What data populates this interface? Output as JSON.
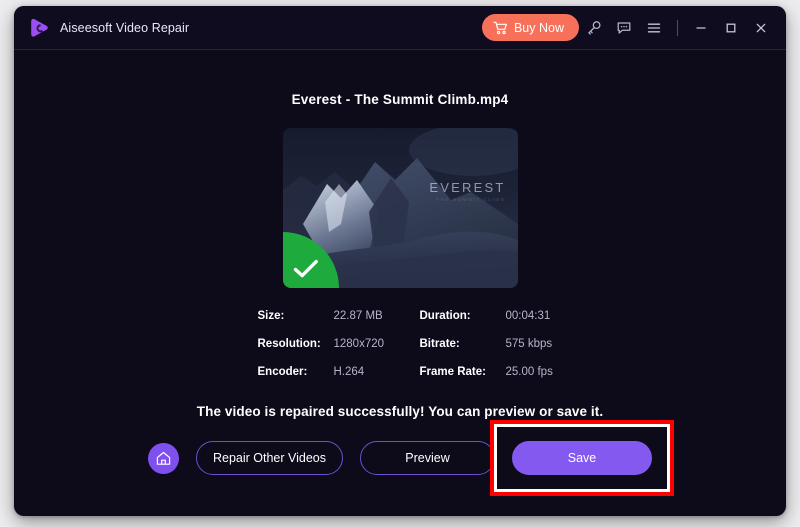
{
  "titlebar": {
    "app_name": "Aiseesoft Video Repair",
    "logo_icon": "aiseesoft-play-logo",
    "buy_now_label": "Buy Now",
    "cart_icon": "shopping-cart-icon",
    "key_icon": "key-icon",
    "feedback_icon": "chat-bubble-icon",
    "menu_icon": "hamburger-menu-icon",
    "minimize_icon": "minimize-icon",
    "maximize_icon": "maximize-icon",
    "close_icon": "close-icon"
  },
  "main": {
    "file_title": "Everest - The Summit Climb.mp4",
    "thumbnail": {
      "overlay_title": "EVEREST",
      "overlay_subtitle": "THE SUMMIT CLIMB",
      "badge_icon": "green-check-badge"
    },
    "metadata": [
      {
        "label": "Size:",
        "value": "22.87 MB"
      },
      {
        "label": "Duration:",
        "value": "00:04:31"
      },
      {
        "label": "Resolution:",
        "value": "1280x720"
      },
      {
        "label": "Bitrate:",
        "value": "575 kbps"
      },
      {
        "label": "Encoder:",
        "value": "H.264"
      },
      {
        "label": "Frame Rate:",
        "value": "25.00 fps"
      }
    ],
    "status_message": "The video is repaired successfully! You can preview or save it.",
    "actions": {
      "home_icon": "home-icon",
      "repair_other_label": "Repair Other Videos",
      "preview_label": "Preview",
      "save_label": "Save"
    }
  },
  "colors": {
    "window_bg": "#0d0a1a",
    "titlebar_bg": "#100c20",
    "accent_purple": "#8359f0",
    "buy_now_orange": "#f7705a",
    "success_green": "#1faa3d",
    "annotation_red": "#ff0000"
  }
}
